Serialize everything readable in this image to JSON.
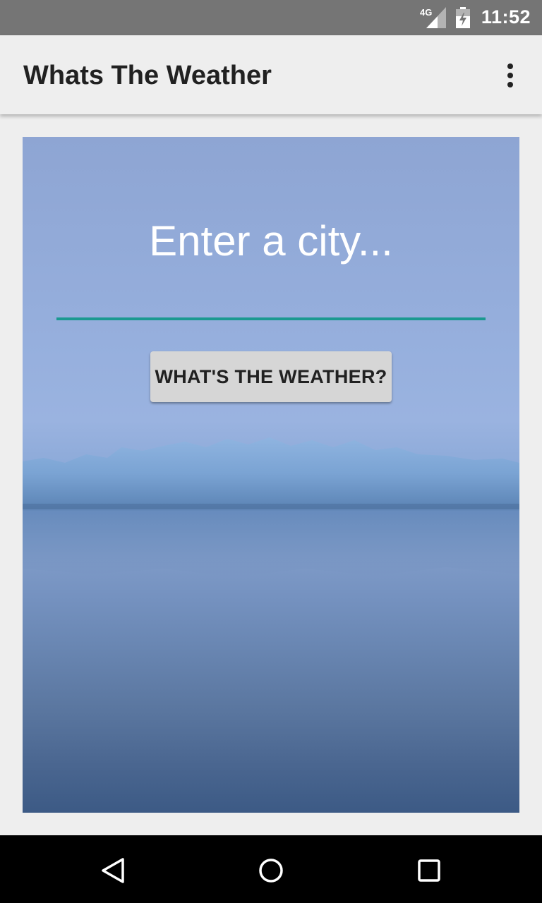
{
  "status_bar": {
    "network": "4G",
    "time": "11:52",
    "icons": [
      "signal-icon",
      "battery-icon"
    ]
  },
  "app_bar": {
    "title": "Whats The Weather",
    "overflow_icon": "more-vert-icon"
  },
  "main": {
    "city_input": {
      "value": "",
      "placeholder": "Enter a city..."
    },
    "button_label": "WHAT'S THE WEATHER?",
    "background_image": "glacier-lake-photo"
  },
  "nav_bar": {
    "icons": [
      "back-icon",
      "home-icon",
      "recents-icon"
    ]
  },
  "colors": {
    "accent": "#1a9990",
    "status_bar": "#757575",
    "app_bar": "#eeeeee",
    "button": "#d6d6d6",
    "nav_bar": "#000000"
  }
}
